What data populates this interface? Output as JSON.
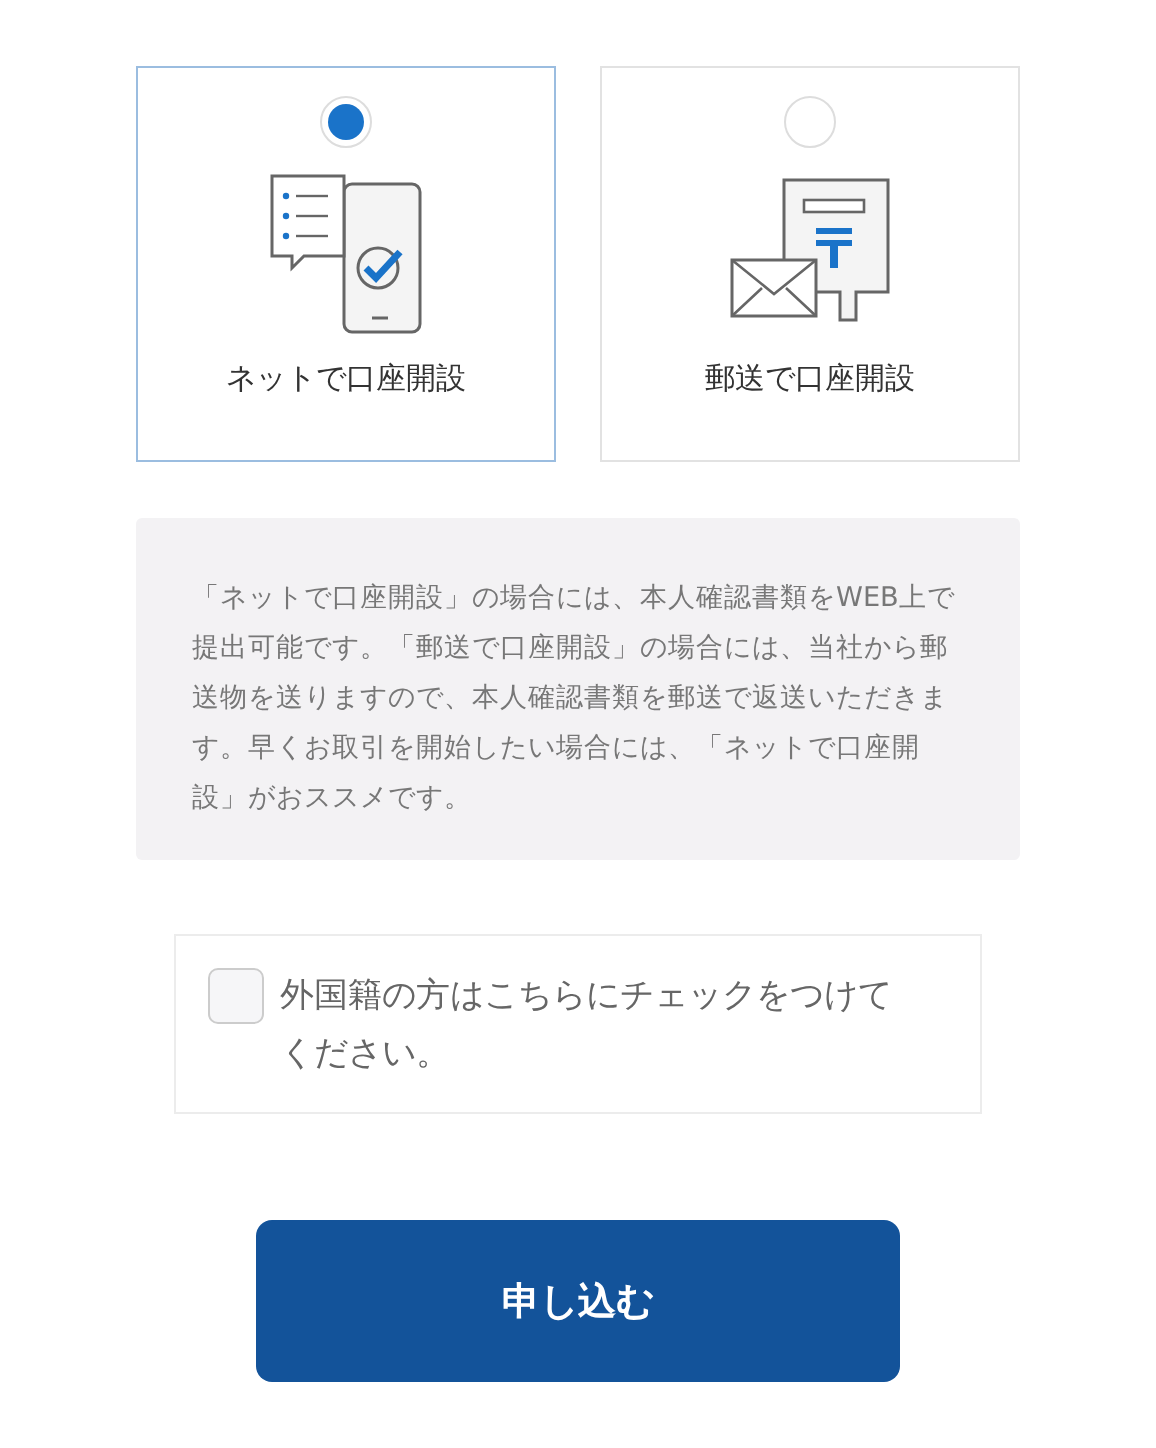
{
  "options": [
    {
      "kind": "online",
      "label": "ネットで口座開設",
      "selected": true
    },
    {
      "kind": "mail",
      "label": "郵送で口座開設",
      "selected": false
    }
  ],
  "note": "「ネットで口座開設」の場合には、本人確認書類をWEB上で提出可能です。「郵送で口座開設」の場合には、当社から郵送物を送りますので、本人確認書類を郵送で返送いただきます。早くお取引を開始したい場合には、「ネットで口座開設」がおススメです。",
  "foreign_checkbox": {
    "label": "外国籍の方はこちらにチェックをつけてください。",
    "checked": false
  },
  "submit_button": "申し込む"
}
